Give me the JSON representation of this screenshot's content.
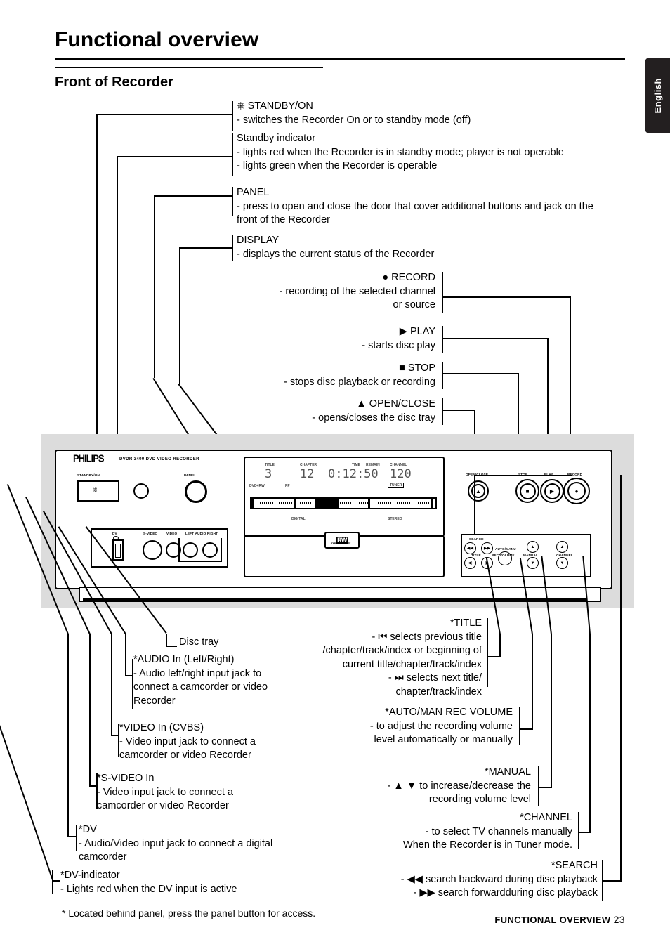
{
  "page": {
    "title": "Functional overview",
    "section_title": "Front of Recorder",
    "language_tab": "English",
    "footnote": "* Located behind panel, press the panel button for access.",
    "footer_label": "FUNCTIONAL OVERVIEW",
    "page_number": "23"
  },
  "callouts_top": [
    {
      "name": "standby-on",
      "heading": "STANDBY/ON",
      "icon": "power-icon",
      "lines": [
        "- switches the Recorder On or to standby mode (off)"
      ]
    },
    {
      "name": "standby-indicator",
      "heading": "Standby indicator",
      "lines": [
        "- lights red when the Recorder is in standby mode; player is not operable",
        "- lights green when the Recorder is operable"
      ]
    },
    {
      "name": "panel",
      "heading": "PANEL",
      "lines": [
        "- press to open and close the door that cover additional buttons and jack on the",
        "front of the Recorder"
      ]
    },
    {
      "name": "display",
      "heading": "DISPLAY",
      "lines": [
        "- displays the current status of the Recorder"
      ]
    }
  ],
  "callouts_right": [
    {
      "name": "record",
      "icon": "record-dot-icon",
      "heading": "RECORD",
      "lines": [
        "- recording of the selected channel",
        "or source"
      ]
    },
    {
      "name": "play",
      "icon": "play-triangle-icon",
      "heading": "PLAY",
      "lines": [
        "- starts disc play"
      ]
    },
    {
      "name": "stop",
      "icon": "stop-square-icon",
      "heading": "STOP",
      "lines": [
        "- stops disc playback or recording"
      ]
    },
    {
      "name": "open-close",
      "icon": "eject-triangle-icon",
      "heading": "OPEN/CLOSE",
      "lines": [
        "- opens/closes the disc tray"
      ]
    }
  ],
  "callouts_bottom_left": [
    {
      "name": "disc-tray",
      "heading": "Disc tray",
      "lines": []
    },
    {
      "name": "audio-in",
      "heading": "*AUDIO In (Left/Right)",
      "lines": [
        "- Audio left/right input jack to",
        "connect a camcorder or video",
        "Recorder"
      ]
    },
    {
      "name": "video-in",
      "heading": "*VIDEO In (CVBS)",
      "lines": [
        "- Video input jack to connect a",
        "camcorder or video Recorder"
      ]
    },
    {
      "name": "s-video-in",
      "heading": "*S-VIDEO In",
      "lines": [
        "- Video input jack to connect a",
        "camcorder or video Recorder"
      ]
    },
    {
      "name": "dv",
      "heading": "*DV",
      "lines": [
        "- Audio/Video input jack to connect a digital",
        "camcorder"
      ]
    },
    {
      "name": "dv-indicator",
      "heading": "*DV-indicator",
      "lines": [
        "- Lights red when the DV input is active"
      ]
    }
  ],
  "callouts_bottom_right": [
    {
      "name": "title",
      "heading": "*TITLE",
      "lines": [
        "- ⏮ selects previous title",
        "/chapter/track/index or beginning of",
        "current title/chapter/track/index",
        "- ⏭ selects next title/",
        "chapter/track/index"
      ]
    },
    {
      "name": "auto-man-rec-volume",
      "heading": "*AUTO/MAN REC VOLUME",
      "lines": [
        "- to adjust the recording volume",
        "level automatically or manually"
      ]
    },
    {
      "name": "manual",
      "heading": "*MANUAL",
      "lines": [
        "- ▲ ▼ to increase/decrease the",
        "recording volume level"
      ]
    },
    {
      "name": "channel",
      "heading": "*CHANNEL",
      "lines": [
        "- to select TV channels manually",
        "When the Recorder is in Tuner mode."
      ]
    },
    {
      "name": "search",
      "heading": "*SEARCH",
      "lines": [
        "- ◀◀ search backward during disc playback",
        "- ▶▶ search forwardduring disc playback"
      ]
    }
  ],
  "device": {
    "brand": "PHILIPS",
    "model": "DVDR 3400   DVD VIDEO RECORDER",
    "standby_label": "STANDBY/ON",
    "panel_label": "PANEL",
    "open_close_label": "OPEN/CLOSE",
    "stop_label": "STOP",
    "play_label": "PLAY",
    "record_label": "RECORD",
    "jack_labels": {
      "dv": "DV",
      "s_video": "S-VIDEO",
      "video": "VIDEO",
      "audio": "LEFT  AUDIO  RIGHT"
    },
    "subpanel_labels": {
      "search": "SEARCH",
      "title": "TITLE",
      "auto_manual": "AUTO/MANU",
      "rec_volume": "REC VOLUME",
      "manual": "MANUAL",
      "channel": "CHANNEL"
    },
    "display": {
      "title_label": "TITLE",
      "title_value": "3",
      "chapter_label": "CHAPTER",
      "chapter_value": "12",
      "time_label": "TIME",
      "remain_label": "REMAIN",
      "time_value": "0:12:50",
      "channel_label": "CHANNEL",
      "channel_value": "120",
      "mode_left": "DVD+RW",
      "mode_mid": "PP",
      "digital_label": "DIGITAL",
      "tuner_badge": "TUNER",
      "stereo_label": "STEREO",
      "rw_logo": "RW",
      "rw_sub": "DVD+ReWritable"
    }
  },
  "colors": {
    "gray_band": "#dcdcdc",
    "tab_background": "#231f20",
    "ink": "#000000"
  }
}
